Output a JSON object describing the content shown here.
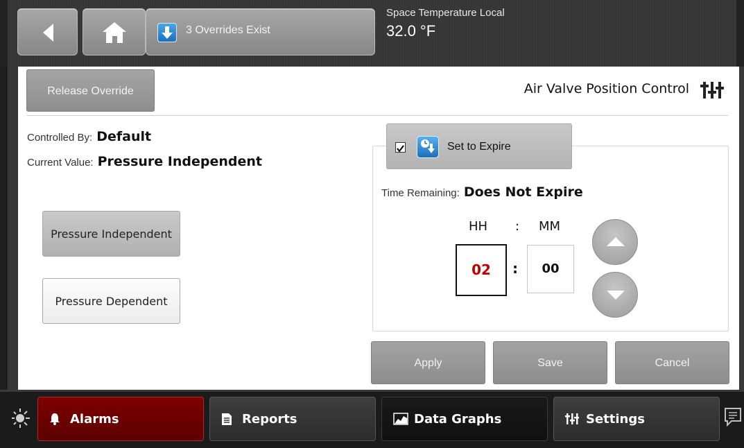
{
  "topbar": {
    "overrides_label": "3 Overrides Exist",
    "status_title": "Space Temperature Local",
    "status_value": "32.0 °F"
  },
  "panel": {
    "release_button": "Release Override",
    "title": "Air Valve Position Control",
    "controlled_by_label": "Controlled By:",
    "controlled_by_value": "Default",
    "current_value_label": "Current Value:",
    "current_value_value": "Pressure Independent",
    "options": [
      "Pressure Independent",
      "Pressure Dependent"
    ],
    "selected_option": "Pressure Independent"
  },
  "expire": {
    "button_label": "Set to Expire",
    "checked": true,
    "time_remaining_label": "Time Remaining:",
    "time_remaining_value": "Does Not Expire",
    "hh_label": "HH",
    "separator": ":",
    "mm_label": "MM",
    "hh_value": "02",
    "mm_value": "00"
  },
  "actions": {
    "apply": "Apply",
    "save": "Save",
    "cancel": "Cancel"
  },
  "nav": {
    "alarms": "Alarms",
    "reports": "Reports",
    "data_graphs": "Data Graphs",
    "settings": "Settings"
  },
  "colors": {
    "alarm_red": "#7d0000",
    "hour_text_red": "#c00000",
    "override_icon_blue": "#1b6fbf"
  }
}
